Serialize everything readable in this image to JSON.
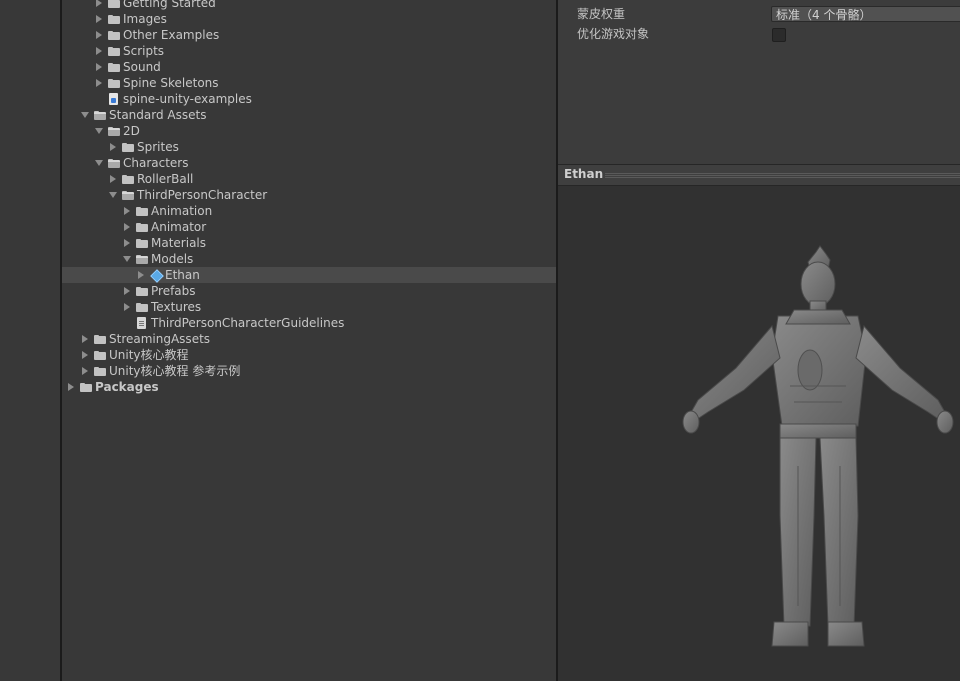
{
  "project_tree": [
    {
      "depth": 2,
      "label": "Getting Started",
      "icon": "folder",
      "expanded": false,
      "has_children": true
    },
    {
      "depth": 2,
      "label": "Images",
      "icon": "folder",
      "expanded": false,
      "has_children": true
    },
    {
      "depth": 2,
      "label": "Other Examples",
      "icon": "folder",
      "expanded": false,
      "has_children": true
    },
    {
      "depth": 2,
      "label": "Scripts",
      "icon": "folder",
      "expanded": false,
      "has_children": true
    },
    {
      "depth": 2,
      "label": "Sound",
      "icon": "folder",
      "expanded": false,
      "has_children": true
    },
    {
      "depth": 2,
      "label": "Spine Skeletons",
      "icon": "folder",
      "expanded": false,
      "has_children": true
    },
    {
      "depth": 2,
      "label": "spine-unity-examples",
      "icon": "package",
      "expanded": false,
      "has_children": false
    },
    {
      "depth": 1,
      "label": "Standard Assets",
      "icon": "folder",
      "expanded": true,
      "has_children": true
    },
    {
      "depth": 2,
      "label": "2D",
      "icon": "folder",
      "expanded": true,
      "has_children": true
    },
    {
      "depth": 3,
      "label": "Sprites",
      "icon": "folder",
      "expanded": false,
      "has_children": true
    },
    {
      "depth": 2,
      "label": "Characters",
      "icon": "folder",
      "expanded": true,
      "has_children": true
    },
    {
      "depth": 3,
      "label": "RollerBall",
      "icon": "folder",
      "expanded": false,
      "has_children": true
    },
    {
      "depth": 3,
      "label": "ThirdPersonCharacter",
      "icon": "folder",
      "expanded": true,
      "has_children": true
    },
    {
      "depth": 4,
      "label": "Animation",
      "icon": "folder",
      "expanded": false,
      "has_children": true
    },
    {
      "depth": 4,
      "label": "Animator",
      "icon": "folder",
      "expanded": false,
      "has_children": true
    },
    {
      "depth": 4,
      "label": "Materials",
      "icon": "folder",
      "expanded": false,
      "has_children": true
    },
    {
      "depth": 4,
      "label": "Models",
      "icon": "folder",
      "expanded": true,
      "has_children": true
    },
    {
      "depth": 5,
      "label": "Ethan",
      "icon": "model",
      "expanded": false,
      "has_children": true,
      "selected": true
    },
    {
      "depth": 4,
      "label": "Prefabs",
      "icon": "folder",
      "expanded": false,
      "has_children": true
    },
    {
      "depth": 4,
      "label": "Textures",
      "icon": "folder",
      "expanded": false,
      "has_children": true
    },
    {
      "depth": 4,
      "label": "ThirdPersonCharacterGuidelines",
      "icon": "file",
      "expanded": false,
      "has_children": false
    },
    {
      "depth": 1,
      "label": "StreamingAssets",
      "icon": "folder",
      "expanded": false,
      "has_children": true
    },
    {
      "depth": 1,
      "label": "Unity核心教程",
      "icon": "folder",
      "expanded": false,
      "has_children": true
    },
    {
      "depth": 1,
      "label": "Unity核心教程 参考示例",
      "icon": "folder",
      "expanded": false,
      "has_children": true
    },
    {
      "depth": 0,
      "label": "Packages",
      "icon": "folder",
      "expanded": false,
      "has_children": true,
      "bold": true
    }
  ],
  "inspector": {
    "skin_weights_label": "蒙皮权重",
    "skin_weights_value": "标准（4 个骨骼）",
    "optimize_label": "优化游戏对象",
    "optimize_checked": false
  },
  "preview": {
    "title": "Ethan"
  },
  "colors": {
    "background": "#383838",
    "selection": "#4a4a4a",
    "preview_bg": "#313131",
    "model_icon": "#5aa9e6"
  }
}
